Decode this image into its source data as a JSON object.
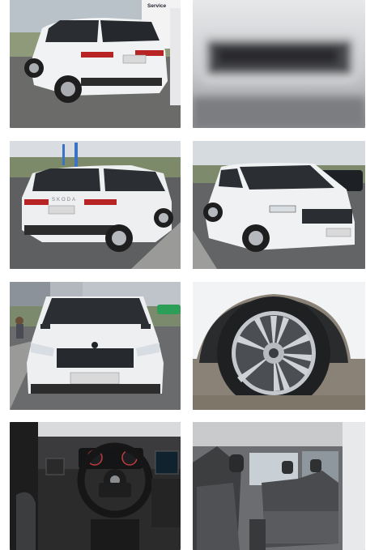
{
  "gallery": {
    "photos": [
      {
        "id": "rear-quarter-dealer",
        "caption": ""
      },
      {
        "id": "blurred-plate-closeup",
        "caption": ""
      },
      {
        "id": "rear-quarter-parking",
        "caption": ""
      },
      {
        "id": "front-quarter-parking",
        "caption": ""
      },
      {
        "id": "front-view",
        "caption": ""
      },
      {
        "id": "alloy-wheel",
        "caption": ""
      },
      {
        "id": "dashboard",
        "caption": ""
      },
      {
        "id": "rear-seats",
        "caption": ""
      }
    ]
  },
  "signage": {
    "dealer_sign": "Service"
  },
  "vehicle": {
    "brand_lettering": "SKODA"
  }
}
